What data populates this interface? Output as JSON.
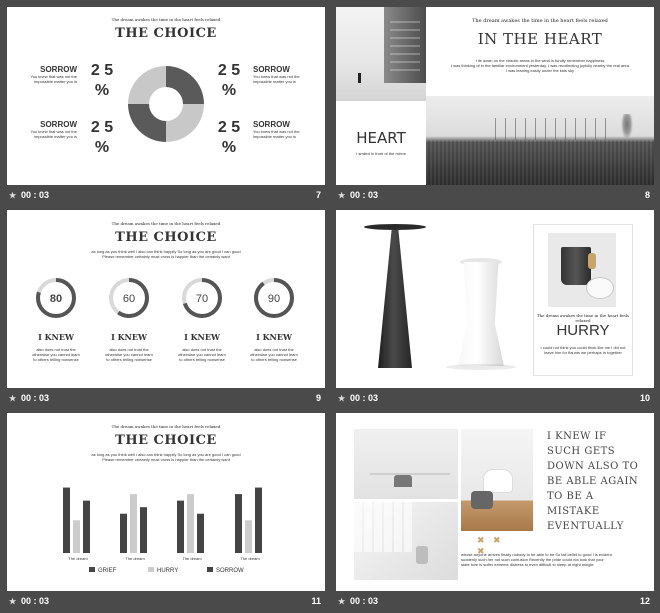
{
  "status": {
    "time": "00 : 03"
  },
  "slides": [
    {
      "number": "7",
      "heading": "The dream awakes the time  in the heart feels relaxed",
      "title": "THE CHOICE",
      "items": [
        {
          "label": "SORROW",
          "desc1": "You knew that was not the",
          "desc2": "impossible matter you is",
          "pct": "2 5",
          "pct_sign": "%"
        },
        {
          "label": "SORROW",
          "desc1": "You knew that was not the",
          "desc2": "impossible matter you is",
          "pct": "2 5",
          "pct_sign": "%"
        },
        {
          "label": "SORROW",
          "desc1": "You knew that was not the",
          "desc2": "impossible matter you is",
          "pct": "2 5",
          "pct_sign": "%"
        },
        {
          "label": "SORROW",
          "desc1": "You knew that was not the",
          "desc2": "impossible matter you is",
          "pct": "2 5",
          "pct_sign": "%"
        }
      ]
    },
    {
      "number": "8",
      "heading": "The dream awakes the time  in the heart feels relaxed",
      "title": "IN THE HEART",
      "body1": "I lie down on the chaotic areas in the wind is fondly remember happiness",
      "body2": "I was thinking of in the familiar  environment yesterday, I was recollecting joyfully nearby the real area",
      "body3": "I was leaning easily under the kids sky",
      "box_title": "HEART",
      "box_text": "I smiled in front of the  mirror"
    },
    {
      "number": "9",
      "heading": "The dream awakes the time  in the heart feels relaxed",
      "title": "THE CHOICE",
      "body1": "as long as you think well I also can think happily So long as you are good  I can good",
      "body2": "Please remember   certainly must cross is happier than the certainly want",
      "rings": [
        {
          "value": "80",
          "label": "I KNEW",
          "d1": "also does not trust the",
          "d2": "otherwise you cannot learn",
          "d3": "to others telling nonsense"
        },
        {
          "value": "60",
          "label": "I KNEW",
          "d1": "also does not trust the",
          "d2": "otherwise you cannot learn",
          "d3": "to others telling nonsense"
        },
        {
          "value": "70",
          "label": "I KNEW",
          "d1": "also does not trust the",
          "d2": "otherwise you cannot learn",
          "d3": "to others telling nonsense"
        },
        {
          "value": "90",
          "label": "I KNEW",
          "d1": "also does not trust the",
          "d2": "otherwise you cannot learn",
          "d3": "to others telling nonsense"
        }
      ]
    },
    {
      "number": "10",
      "subtitle": "The dream awakes the time  in the heart feels relaxed",
      "title": "HURRY",
      "body1": "I could not think you could think like me  I did not",
      "body2": "leave him for flaunts we perhaps in together"
    },
    {
      "number": "11",
      "heading": "The dream awakes the time  in the heart feels relaxed",
      "title": "THE CHOICE",
      "body1": "as long as you think well I also can think happily So long as you are good  I can good",
      "body2": "Please remember   certainly must cross is happier than the certainly want"
    },
    {
      "number": "12",
      "quote": "I KNEW IF SUCH GETS DOWN ALSO TO BE ABLE AGAIN TO BE A MISTAKE EVENTUALLY",
      "body1": "whose anyone arrives finally nobody to be able to be So tail belief to good  I is evident",
      "body2": "suddenly  such her not such confusion  Recently the pride could not look that your",
      "body3": "state love is suffer extreme distress to even difficult to sleep at night mingle"
    }
  ],
  "chart_data": [
    {
      "type": "pie",
      "values": [
        25,
        25,
        25,
        25
      ],
      "colors": [
        "#5a5a5a",
        "#c8c8c8",
        "#5a5a5a",
        "#c8c8c8"
      ]
    },
    {
      "type": "bar",
      "categories": [
        "The dream",
        "The dream",
        "The dream",
        "The dream"
      ],
      "series": [
        {
          "name": "GRIEF",
          "values": [
            10,
            6,
            8,
            9
          ]
        },
        {
          "name": "HURRY",
          "values": [
            5,
            9,
            9,
            5
          ]
        },
        {
          "name": "SORROW",
          "values": [
            8,
            7,
            6,
            10
          ]
        }
      ],
      "colors": [
        "#444444",
        "#cccccc",
        "#444444"
      ],
      "ylim": [
        0,
        11
      ],
      "grid": false,
      "legend_placement": "bottom"
    }
  ],
  "ring_data": [
    80,
    60,
    70,
    90
  ],
  "colors": {
    "dark": "#4a4a4a",
    "ring_dark": "#555555",
    "ring_light": "#d9d9d9",
    "accent": "#c8a46a"
  }
}
